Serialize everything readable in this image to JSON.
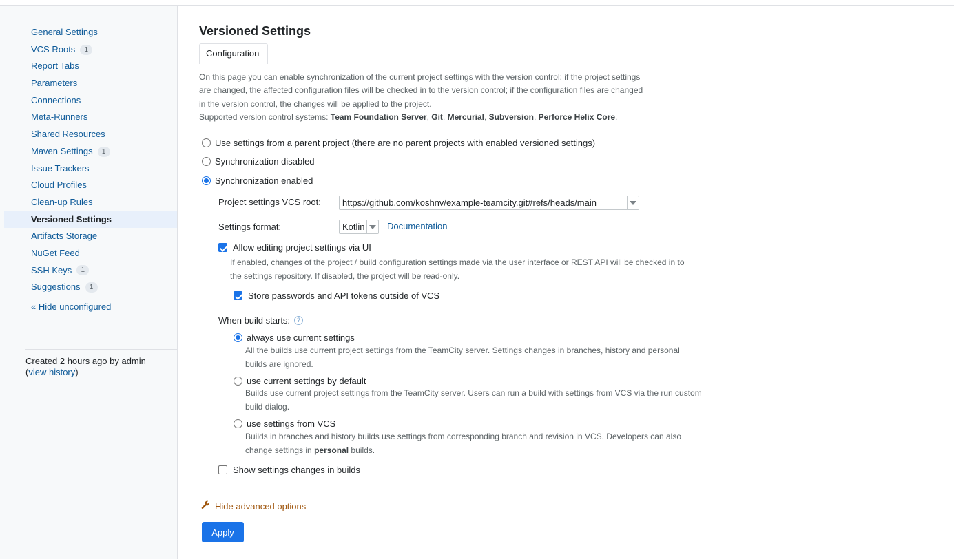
{
  "sidebar": {
    "items": [
      {
        "label": "General Settings",
        "count": ""
      },
      {
        "label": "VCS Roots",
        "count": "1"
      },
      {
        "label": "Report Tabs",
        "count": ""
      },
      {
        "label": "Parameters",
        "count": ""
      },
      {
        "label": "Connections",
        "count": ""
      },
      {
        "label": "Meta-Runners",
        "count": ""
      },
      {
        "label": "Shared Resources",
        "count": ""
      },
      {
        "label": "Maven Settings",
        "count": "1"
      },
      {
        "label": "Issue Trackers",
        "count": ""
      },
      {
        "label": "Cloud Profiles",
        "count": ""
      },
      {
        "label": "Clean-up Rules",
        "count": ""
      },
      {
        "label": "Versioned Settings",
        "count": ""
      },
      {
        "label": "Artifacts Storage",
        "count": ""
      },
      {
        "label": "NuGet Feed",
        "count": ""
      },
      {
        "label": "SSH Keys",
        "count": "1"
      },
      {
        "label": "Suggestions",
        "count": "1"
      }
    ],
    "active_index": 11,
    "hide_unconfigured": "« Hide unconfigured",
    "created_text": "Created 2 hours ago by admin",
    "open_paren": "(",
    "view_history": "view history",
    "close_paren": ")"
  },
  "main": {
    "title": "Versioned Settings",
    "tab": "Configuration",
    "intro": {
      "line1": "On this page you can enable synchronization of the current project settings with the version control: if the project settings",
      "line2": "are changed, the affected configuration files will be checked in to the version control; if the configuration files are changed",
      "line3": "in the version control, the changes will be applied to the project.",
      "supported_prefix": "Supported version control systems: ",
      "vcs1": "Team Foundation Server",
      "sep": ", ",
      "vcs2": "Git",
      "vcs3": "Mercurial",
      "vcs4": "Subversion",
      "vcs5": "Perforce Helix Core",
      "end": "."
    },
    "sync": {
      "opt_parent": "Use settings from a parent project (there are no parent projects with enabled versioned settings)",
      "opt_disabled": "Synchronization disabled",
      "opt_enabled": "Synchronization enabled",
      "selected": "enabled"
    },
    "vcs_root_label": "Project settings VCS root:",
    "vcs_root_value": "https://github.com/koshnv/example-teamcity.git#refs/heads/main",
    "format_label": "Settings format:",
    "format_value": "Kotlin",
    "documentation": "Documentation",
    "allow_editing": {
      "label": "Allow editing project settings via UI",
      "checked": true,
      "note1": "If enabled, changes of the project / build configuration settings made via the user interface or REST API will be checked in to",
      "note2": "the settings repository. If disabled, the project will be read-only."
    },
    "store_passwords": {
      "label": "Store passwords and API tokens outside of VCS",
      "checked": true
    },
    "when_build_starts": "When build starts:",
    "help_icon": "?",
    "build_options": [
      {
        "label": "always use current settings",
        "note1": "All the builds use current project settings from the TeamCity server. Settings changes in branches, history and personal",
        "note2": "builds are ignored.",
        "selected": true
      },
      {
        "label": "use current settings by default",
        "note1": "Builds use current project settings from the TeamCity server. Users can run a build with settings from VCS via the run custom",
        "note2": "build dialog.",
        "selected": false
      },
      {
        "label": "use settings from VCS",
        "note1": "Builds in branches and history builds use settings from corresponding branch and revision in VCS. Developers can also",
        "note2_prefix": "change settings in ",
        "note2_bold": "personal",
        "note2_suffix": " builds.",
        "selected": false
      }
    ],
    "show_changes": {
      "label": "Show settings changes in builds",
      "checked": false
    },
    "hide_advanced": "Hide advanced options",
    "wrench_icon": "wrench-icon",
    "apply": "Apply"
  },
  "colors": {
    "accent": "#1a73e8",
    "link": "#0f5b99",
    "advanced_link": "#a0570f",
    "sidebar_bg": "#f7f9fa",
    "active_item_bg": "#e8f0fb"
  }
}
